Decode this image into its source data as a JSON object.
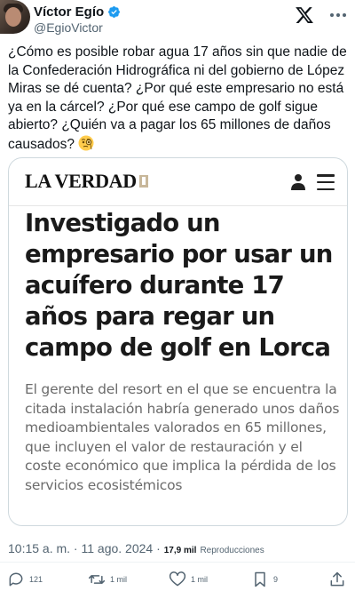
{
  "author": {
    "name": "Víctor Egío",
    "handle": "@EgioVictor"
  },
  "tweet": {
    "text": "¿Cómo es posible robar agua 17 años sin que nadie de la Confederación Hidrográfica ni del gobierno de López Miras se dé cuenta? ¿Por qué este empresario no está ya en la cárcel? ¿Por qué ese campo de golf sigue abierto? ¿Quién va a pagar los 65 millones de daños causados?",
    "emoji": "face-with-monocle"
  },
  "card": {
    "publication": "LA VERDAD",
    "headline": "Investigado un empresario por usar un acuífero durante 17 años para regar un campo de golf en Lorca",
    "deck": "El gerente del resort en el que se encuentra la citada instalación habría generado unos daños medioambientales valorados en 65 millones, que incluyen el valor de restauración y el coste económico que implica la pérdida de los servicios ecosistémicos"
  },
  "meta": {
    "time": "10:15 a. m. · 11 ago. 2024 ·",
    "views_count": "17,9 mil",
    "views_label": "Reproducciones"
  },
  "actions": {
    "replies": "121",
    "reposts": "1 mil",
    "likes": "1 mil",
    "bookmarks": "9"
  },
  "colors": {
    "verified": "#1d9bf0",
    "secondary_text": "#536471",
    "border": "#cfd9de"
  }
}
